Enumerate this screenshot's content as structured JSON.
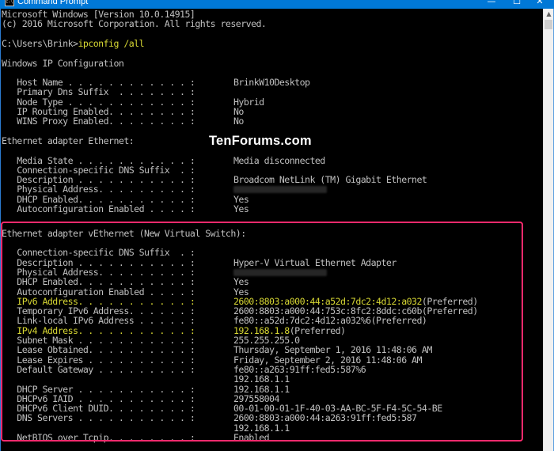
{
  "window": {
    "title": "Command Prompt",
    "app_icon": "cmd-icon",
    "controls": {
      "minimize": "—",
      "maximize": "☐",
      "close": "✕"
    },
    "accent_color": "#0078d7"
  },
  "console": {
    "header": [
      "Microsoft Windows [Version 10.0.14915]",
      "(c) 2016 Microsoft Corporation. All rights reserved."
    ],
    "prompt": "C:\\Users\\Brink>",
    "command": "ipconfig /all",
    "section_title": "Windows IP Configuration",
    "windows_ip": [
      {
        "label": "   Host Name . . . . . . . . . . . . :",
        "value": "BrinkW10Desktop"
      },
      {
        "label": "   Primary Dns Suffix  . . . . . . . :",
        "value": ""
      },
      {
        "label": "   Node Type . . . . . . . . . . . . :",
        "value": "Hybrid"
      },
      {
        "label": "   IP Routing Enabled. . . . . . . . :",
        "value": "No"
      },
      {
        "label": "   WINS Proxy Enabled. . . . . . . . :",
        "value": "No"
      }
    ],
    "adapter1": {
      "title": "Ethernet adapter Ethernet:",
      "rows": [
        {
          "label": "   Media State . . . . . . . . . . . :",
          "value": "Media disconnected"
        },
        {
          "label": "   Connection-specific DNS Suffix  . :",
          "value": ""
        },
        {
          "label": "   Description . . . . . . . . . . . :",
          "value": "Broadcom NetLink (TM) Gigabit Ethernet"
        },
        {
          "label": "   Physical Address. . . . . . . . . :",
          "value": "",
          "redacted": true
        },
        {
          "label": "   DHCP Enabled. . . . . . . . . . . :",
          "value": "Yes"
        },
        {
          "label": "   Autoconfiguration Enabled . . . . :",
          "value": "Yes"
        }
      ]
    },
    "adapter2": {
      "title": "Ethernet adapter vEthernet (New Virtual Switch):",
      "rows": [
        {
          "label": "   Connection-specific DNS Suffix  . :",
          "value": ""
        },
        {
          "label": "   Description . . . . . . . . . . . :",
          "value": "Hyper-V Virtual Ethernet Adapter"
        },
        {
          "label": "   Physical Address. . . . . . . . . :",
          "value": "",
          "redacted": true
        },
        {
          "label": "   DHCP Enabled. . . . . . . . . . . :",
          "value": "Yes"
        },
        {
          "label": "   Autoconfiguration Enabled . . . . :",
          "value": "Yes"
        },
        {
          "label": "   IPv6 Address. . . . . . . . . . . :",
          "value": "2600:8803:a000:44:a52d:7dc2:4d12:a032",
          "suffix": "(Preferred)",
          "highlighted": true
        },
        {
          "label": "   Temporary IPv6 Address. . . . . . :",
          "value": "2600:8803:a000:44:753c:8fc2:8ddc:c60b",
          "suffix": "(Preferred)"
        },
        {
          "label": "   Link-local IPv6 Address . . . . . :",
          "value": "fe80::a52d:7dc2:4d12:a032%6",
          "suffix": "(Preferred)"
        },
        {
          "label": "   IPv4 Address. . . . . . . . . . . :",
          "value": "192.168.1.8",
          "suffix": "(Preferred)",
          "highlighted": true
        },
        {
          "label": "   Subnet Mask . . . . . . . . . . . :",
          "value": "255.255.255.0"
        },
        {
          "label": "   Lease Obtained. . . . . . . . . . :",
          "value": "Thursday, September 1, 2016 11:48:06 AM"
        },
        {
          "label": "   Lease Expires . . . . . . . . . . :",
          "value": "Friday, September 2, 2016 11:48:06 AM"
        },
        {
          "label": "   Default Gateway . . . . . . . . . :",
          "value": "fe80::a263:91ff:fed5:587%6"
        },
        {
          "label": "",
          "value": "192.168.1.1"
        },
        {
          "label": "   DHCP Server . . . . . . . . . . . :",
          "value": "192.168.1.1"
        },
        {
          "label": "   DHCPv6 IAID . . . . . . . . . . . :",
          "value": "297558004"
        },
        {
          "label": "   DHCPv6 Client DUID. . . . . . . . :",
          "value": "00-01-00-01-1F-40-03-AA-BC-5F-F4-5C-54-BE"
        },
        {
          "label": "   DNS Servers . . . . . . . . . . . :",
          "value": "2600:8803:a000:44:a263:91ff:fed5:587"
        },
        {
          "label": "",
          "value": "192.168.1.1"
        },
        {
          "label": "   NetBIOS over Tcpip. . . . . . . . :",
          "value": "Enabled"
        }
      ]
    },
    "text_color": "#c0c0c0",
    "highlight_text_color": "#d7d733"
  },
  "watermark": "TenForums.com",
  "annotation": {
    "color": "#ff2a6d",
    "target": "vEthernet adapter section"
  }
}
